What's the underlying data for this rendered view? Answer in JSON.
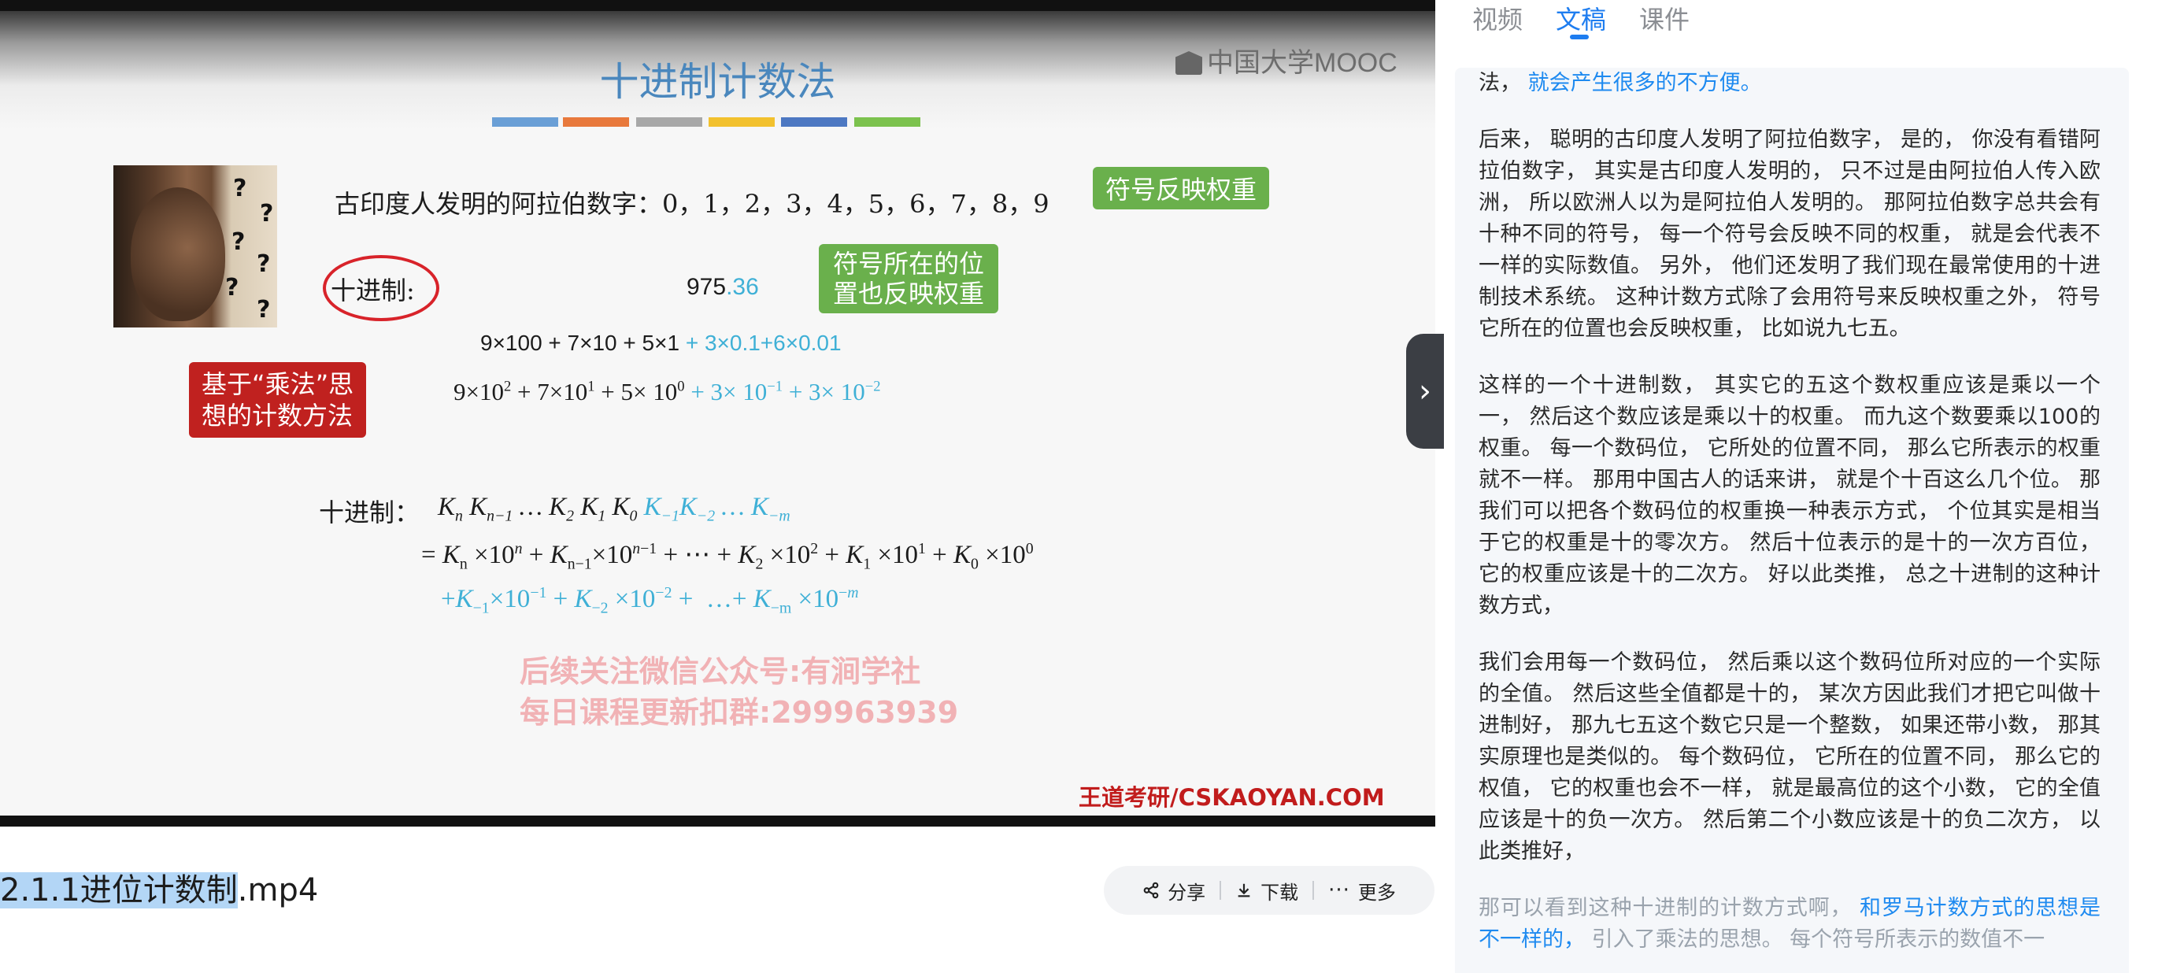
{
  "slide": {
    "title": "十进制计数法",
    "logo": "中国大学MOOC",
    "colorbar": [
      "#6a9fd6",
      "#e8793c",
      "#a8a8a8",
      "#f2c12e",
      "#4d78c2",
      "#7cc24e"
    ],
    "arabic_line": "古印度人发明的阿拉伯数字：0，1，2，3，4，5，6，7，8，9",
    "bubble_weight": "符号反映权重",
    "decimal_label": "十进制:",
    "num_int": "975",
    "num_frac": ".36",
    "bubble_position_1": "符号所在的位",
    "bubble_position_2": "置也反映权重",
    "expansion1_black": "9×100 + 7×10 + 5×1",
    "expansion1_blue": "+ 3×0.1+6×0.01",
    "method_1": "基于“乘法”思",
    "method_2": "想的计数方法",
    "decimal_label2": "十进制：",
    "watermark_1": "后续关注微信公众号:有涧学社",
    "watermark_2": "每日课程更新扣群:299963939",
    "brand": "王道考研/CSKAOYAN.COM"
  },
  "file": {
    "name_selected": "2.1.1进位计数制",
    "name_rest": ".mp4"
  },
  "actions": {
    "share": "分享",
    "download": "下载",
    "more": "更多"
  },
  "tabs": [
    "视频",
    "文稿",
    "课件"
  ],
  "transcript": {
    "p0_a": "法，",
    "p0_b": "就会产生很多的不方便。",
    "p1": "后来， 聪明的古印度人发明了阿拉伯数字， 是的， 你没有看错阿拉伯数字， 其实是古印度人发明的， 只不过是由阿拉伯人传入欧洲， 所以欧洲人以为是阿拉伯人发明的。 那阿拉伯数字总共会有十种不同的符号， 每一个符号会反映不同的权重， 就是会代表不一样的实际数值。 另外， 他们还发明了我们现在最常使用的十进制技术系统。 这种计数方式除了会用符号来反映权重之外， 符号它所在的位置也会反映权重， 比如说九七五。",
    "p2": "这样的一个十进制数， 其实它的五这个数权重应该是乘以一个一， 然后这个数应该是乘以十的权重。 而九这个数要乘以100的权重。 每一个数码位， 它所处的位置不同， 那么它所表示的权重就不一样。 那用中国古人的话来讲， 就是个十百这么几个位。 那我们可以把各个数码位的权重换一种表示方式， 个位其实是相当于它的权重是十的零次方。 然后十位表示的是十的一次方百位， 它的权重应该是十的二次方。 好以此类推， 总之十进制的这种计数方式，",
    "p3": "我们会用每一个数码位， 然后乘以这个数码位所对应的一个实际的全值。 然后这些全值都是十的， 某次方因此我们才把它叫做十进制好， 那九七五这个数它只是一个整数， 如果还带小数， 那其实原理也是类似的。 每个数码位， 它所在的位置不同， 那么它的权值， 它的权重也会不一样， 就是最高位的这个小数， 它的全值应该是十的负一次方。 然后第二个小数应该是十的负二次方， 以此类推好，",
    "p4_a": "那可以看到这种十进制的计数方式啊，",
    "p4_b": "和罗马计数方式的思想是不一样的，",
    "p4_c": "引入了乘法的思想。 每个符号所表示的数值不一"
  }
}
